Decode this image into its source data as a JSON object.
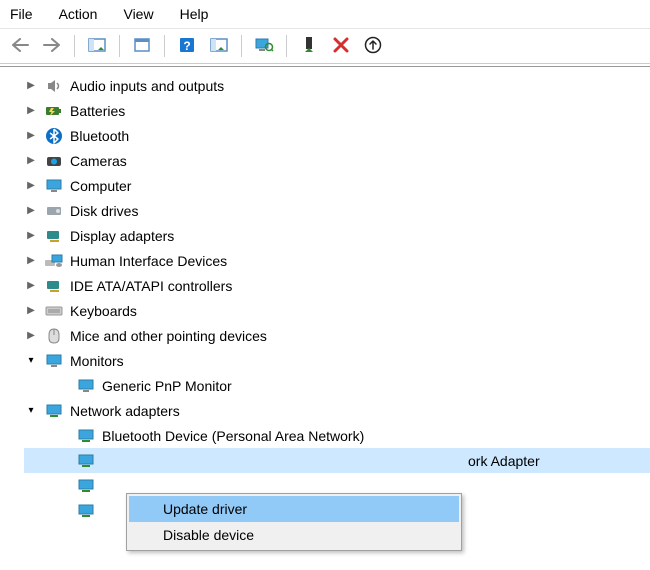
{
  "menu": {
    "file": "File",
    "action": "Action",
    "view": "View",
    "help": "Help"
  },
  "toolbar_icons": {
    "back": "back-arrow-icon",
    "forward": "forward-arrow-icon",
    "showhide": "showhide-icon",
    "export": "export-icon",
    "help": "help-icon",
    "refresh": "refresh-icon",
    "scan": "scan-hardware-icon",
    "enable": "enable-device-icon",
    "delete": "delete-icon",
    "update": "update-icon"
  },
  "tree": {
    "audio": "Audio inputs and outputs",
    "batteries": "Batteries",
    "bluetooth": "Bluetooth",
    "cameras": "Cameras",
    "computer": "Computer",
    "disk_drives": "Disk drives",
    "display_adapters": "Display adapters",
    "hid": "Human Interface Devices",
    "ide": "IDE ATA/ATAPI controllers",
    "keyboards": "Keyboards",
    "mice": "Mice and other pointing devices",
    "monitors": "Monitors",
    "generic_monitor": "Generic PnP Monitor",
    "net_adapters": "Network adapters",
    "net_bt": "Bluetooth Device (Personal Area Network)",
    "net_selected_suffix": "ork Adapter"
  },
  "context_menu": {
    "update": "Update driver",
    "disable": "Disable device"
  },
  "colors": {
    "selection": "#cde8ff",
    "ctx_hover": "#91c9f7"
  }
}
